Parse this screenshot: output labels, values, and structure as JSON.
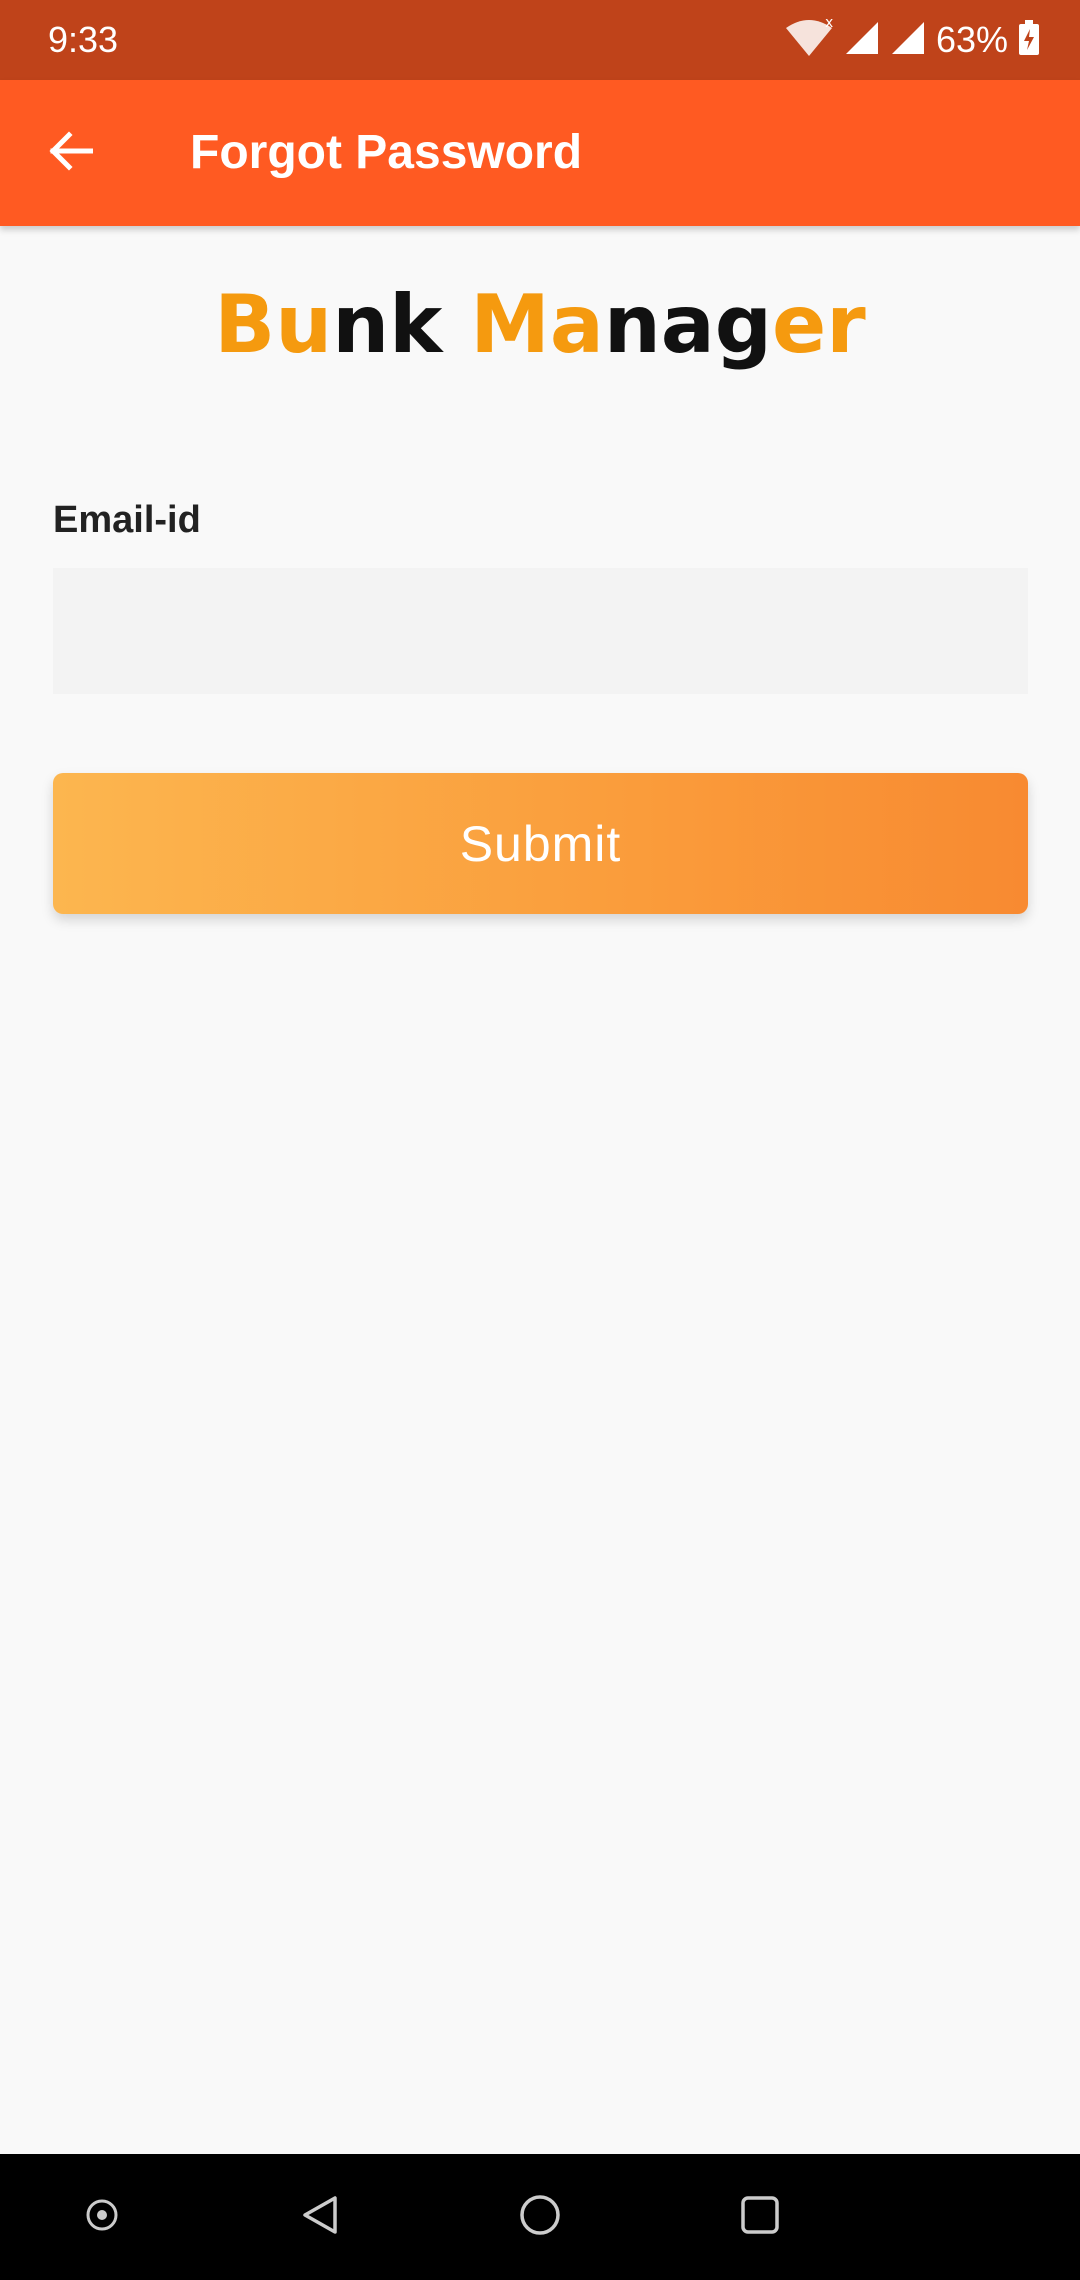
{
  "status_bar": {
    "time": "9:33",
    "battery_percent": "63%",
    "icons": [
      "wifi-icon",
      "signal-icon",
      "signal-icon",
      "battery-charging-icon"
    ]
  },
  "app_bar": {
    "title": "Forgot Password",
    "back_icon": "arrow-left-icon"
  },
  "logo": {
    "text": "Bunk Manager",
    "letters": [
      {
        "char": "B",
        "color": "#f59a0f"
      },
      {
        "char": "u",
        "color": "#f59a0f"
      },
      {
        "char": "n",
        "color": "#111111"
      },
      {
        "char": "k",
        "color": "#111111"
      },
      {
        "char": " ",
        "color": "#111111"
      },
      {
        "char": "M",
        "color": "#f59a0f"
      },
      {
        "char": "a",
        "color": "#f59a0f"
      },
      {
        "char": "n",
        "color": "#111111"
      },
      {
        "char": "a",
        "color": "#111111"
      },
      {
        "char": "g",
        "color": "#111111"
      },
      {
        "char": "e",
        "color": "#f59a0f"
      },
      {
        "char": "r",
        "color": "#f59a0f"
      }
    ]
  },
  "form": {
    "email_label": "Email-id",
    "email_value": "",
    "email_placeholder": "",
    "submit_label": "Submit"
  },
  "nav_bar": {
    "buttons": [
      "assistant-icon",
      "back-triangle-icon",
      "home-circle-icon",
      "recents-square-icon"
    ]
  },
  "colors": {
    "status_bar": "#bf431a",
    "app_bar": "#ff5a22",
    "accent": "#f59a0f",
    "button_gradient_start": "#fcb64f",
    "button_gradient_end": "#f88a31"
  }
}
